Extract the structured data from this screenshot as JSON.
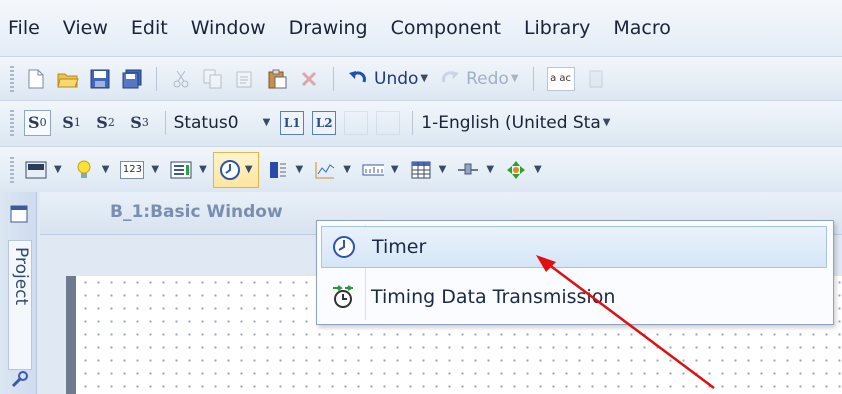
{
  "menubar": {
    "items": [
      "File",
      "View",
      "Edit",
      "Window",
      "Drawing",
      "Component",
      "Library",
      "Macro"
    ]
  },
  "toolbar1": {
    "undo_label": "Undo",
    "redo_label": "Redo",
    "spell_label": "a ac"
  },
  "toolbar2": {
    "state_buttons": [
      {
        "base": "S",
        "sub": "0"
      },
      {
        "base": "S",
        "sub": "1"
      },
      {
        "base": "S",
        "sub": "2"
      },
      {
        "base": "S",
        "sub": "3"
      }
    ],
    "status_value": "Status0",
    "l_buttons": [
      "L1",
      "L2"
    ],
    "language_value": "1-English (United Sta"
  },
  "toolbar3": {
    "counter_label": "123"
  },
  "sidebar": {
    "project_label": "Project"
  },
  "document": {
    "tab_title": "B_1:Basic Window"
  },
  "dropdown": {
    "items": [
      {
        "label": "Timer",
        "icon": "clock-icon"
      },
      {
        "label": "Timing Data Transmission",
        "icon": "timing-transmission-icon"
      }
    ]
  },
  "annotation": {
    "arrow_color": "#e01010"
  }
}
